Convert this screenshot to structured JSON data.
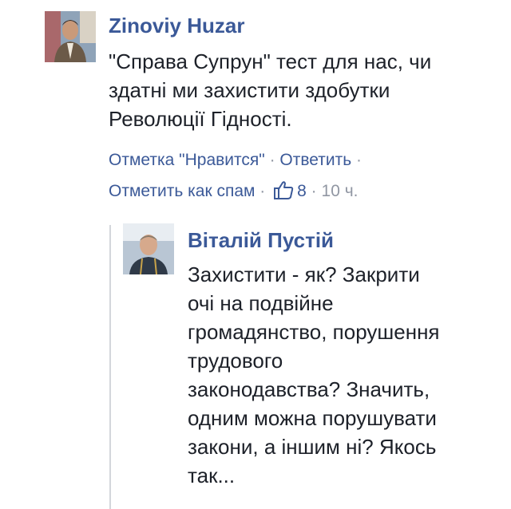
{
  "comment": {
    "author": "Zinoviy Huzar",
    "text_lines": [
      "\"Справа Супрун\" тест для нас, чи",
      "здатні ми захистити здобутки",
      "Революції Гідності."
    ],
    "actions": {
      "like_label": "Отметка \"Нравится\"",
      "reply_label": "Ответить",
      "spam_label": "Отметить как спам",
      "separator": "·",
      "like_count": "8",
      "time": "10 ч."
    }
  },
  "reply": {
    "author": "Віталій Пустій",
    "text_lines": [
      "Захистити - як? Закрити",
      "очі на подвійне",
      "громадянство, порушення",
      "трудового",
      "законодавства? Значить,",
      "одним можна порушувати",
      "закони, а іншим ні? Якось",
      "так..."
    ]
  },
  "colors": {
    "link": "#3b5998",
    "meta": "#9197a3",
    "text": "#1d2129"
  },
  "icons": {
    "like": "thumbs-up-icon"
  }
}
